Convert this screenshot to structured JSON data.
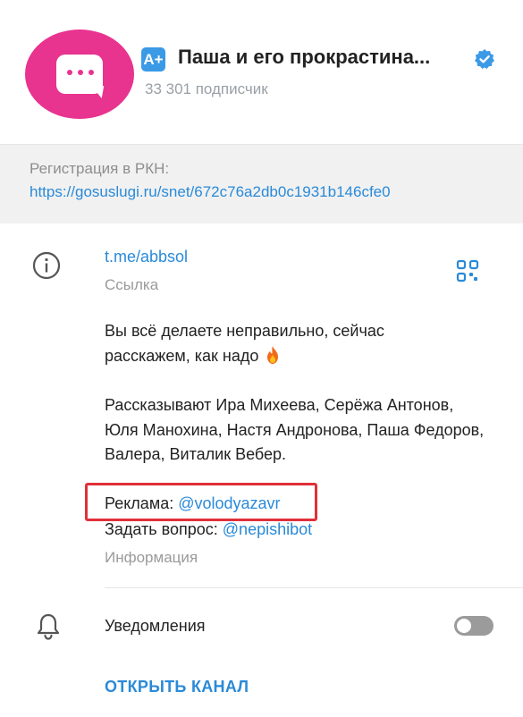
{
  "header": {
    "title": "Паша и его прокрастина...",
    "badge": "A+",
    "subscribers": "33 301 подписчик",
    "verified_icon": "verified-check-icon"
  },
  "registration": {
    "label": "Регистрация в РКН:",
    "link": "https://gosuslugi.ru/snet/672c76a2db0c1931b146cfe0"
  },
  "info": {
    "link": "t.me/abbsol",
    "link_caption": "Ссылка",
    "description_line1": "Вы всё делаете неправильно, сейчас",
    "description_line2": "расскажем, как надо",
    "hosts": "Рассказывают Ира Михеева, Серёжа Антонов, Юля Манохина, Настя Андронова, Паша Федоров, Валера, Виталик Вебер.",
    "ad_label": "Реклама:",
    "ad_mention": "@volodyazavr",
    "ask_label": "Задать вопрос:",
    "ask_mention": "@nepishibot",
    "caption": "Информация"
  },
  "notifications": {
    "label": "Уведомления",
    "enabled": false
  },
  "actions": {
    "open_channel": "ОТКРЫТЬ КАНАЛ"
  },
  "colors": {
    "accent": "#2a8ad8",
    "avatar": "#e8338f",
    "highlight": "#e0303a"
  }
}
